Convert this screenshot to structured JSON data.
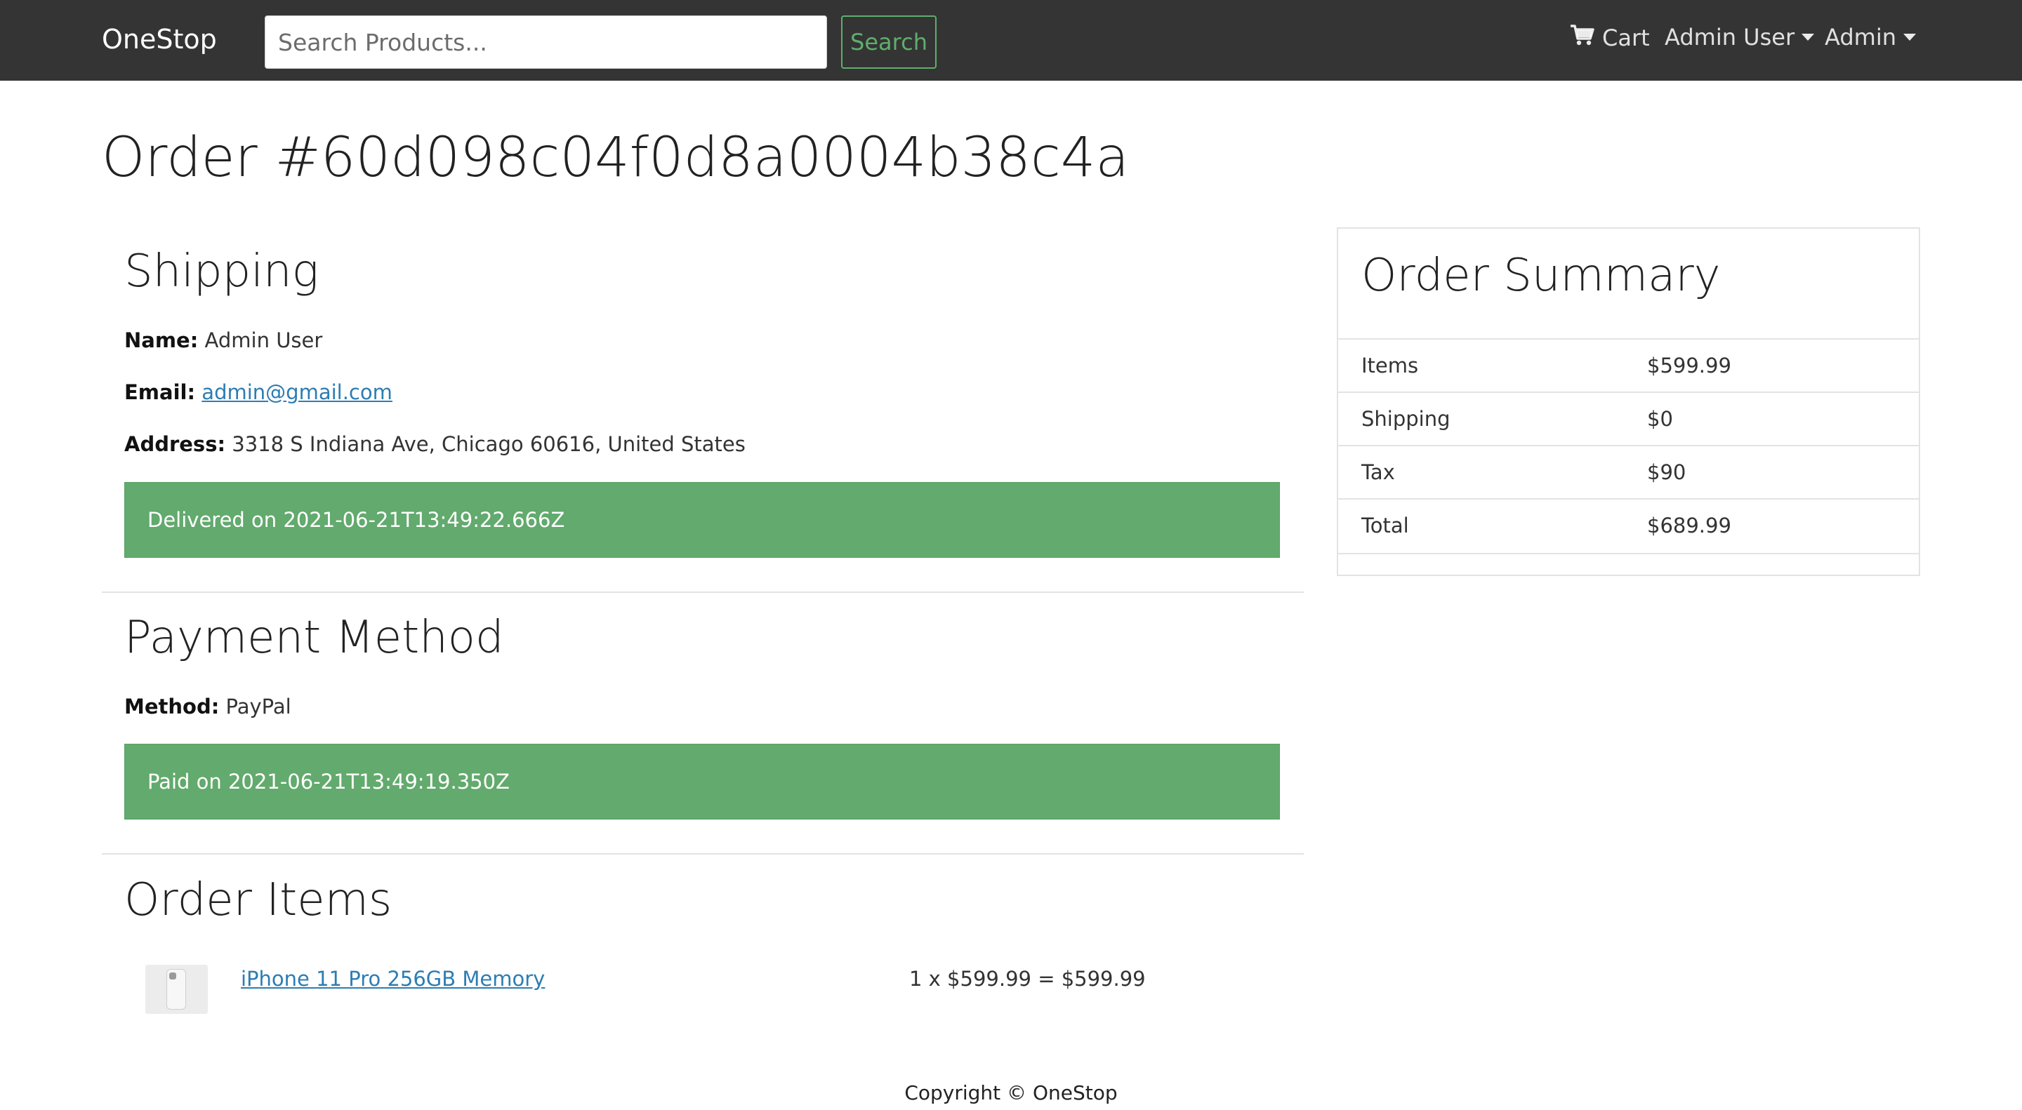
{
  "navbar": {
    "brand": "OneStop",
    "search_placeholder": "Search Products...",
    "search_label": "Search",
    "cart_label": "Cart",
    "user_menu_label": "Admin User",
    "admin_menu_label": "Admin"
  },
  "page": {
    "title": "Order #60d098c04f0d8a0004b38c4a"
  },
  "shipping": {
    "heading": "Shipping",
    "name_label": "Name:",
    "name": "Admin User",
    "email_label": "Email:",
    "email": "admin@gmail.com",
    "address_label": "Address:",
    "address": "3318 S Indiana Ave, Chicago 60616, United States",
    "status": "Delivered on 2021-06-21T13:49:22.666Z"
  },
  "payment": {
    "heading": "Payment Method",
    "method_label": "Method:",
    "method": "PayPal",
    "status": "Paid on 2021-06-21T13:49:19.350Z"
  },
  "order_items": {
    "heading": "Order Items",
    "items": [
      {
        "name": "iPhone 11 Pro 256GB Memory",
        "calc": "1 x $599.99 = $599.99"
      }
    ]
  },
  "summary": {
    "heading": "Order Summary",
    "rows": [
      {
        "label": "Items",
        "value": "$599.99"
      },
      {
        "label": "Shipping",
        "value": "$0"
      },
      {
        "label": "Tax",
        "value": "$90"
      },
      {
        "label": "Total",
        "value": "$689.99"
      }
    ]
  },
  "footer": {
    "copyright": "Copyright © OneStop"
  },
  "colors": {
    "navbar_bg": "#343434",
    "success_green": "#62aa6d",
    "link_blue": "#2d7db3"
  }
}
